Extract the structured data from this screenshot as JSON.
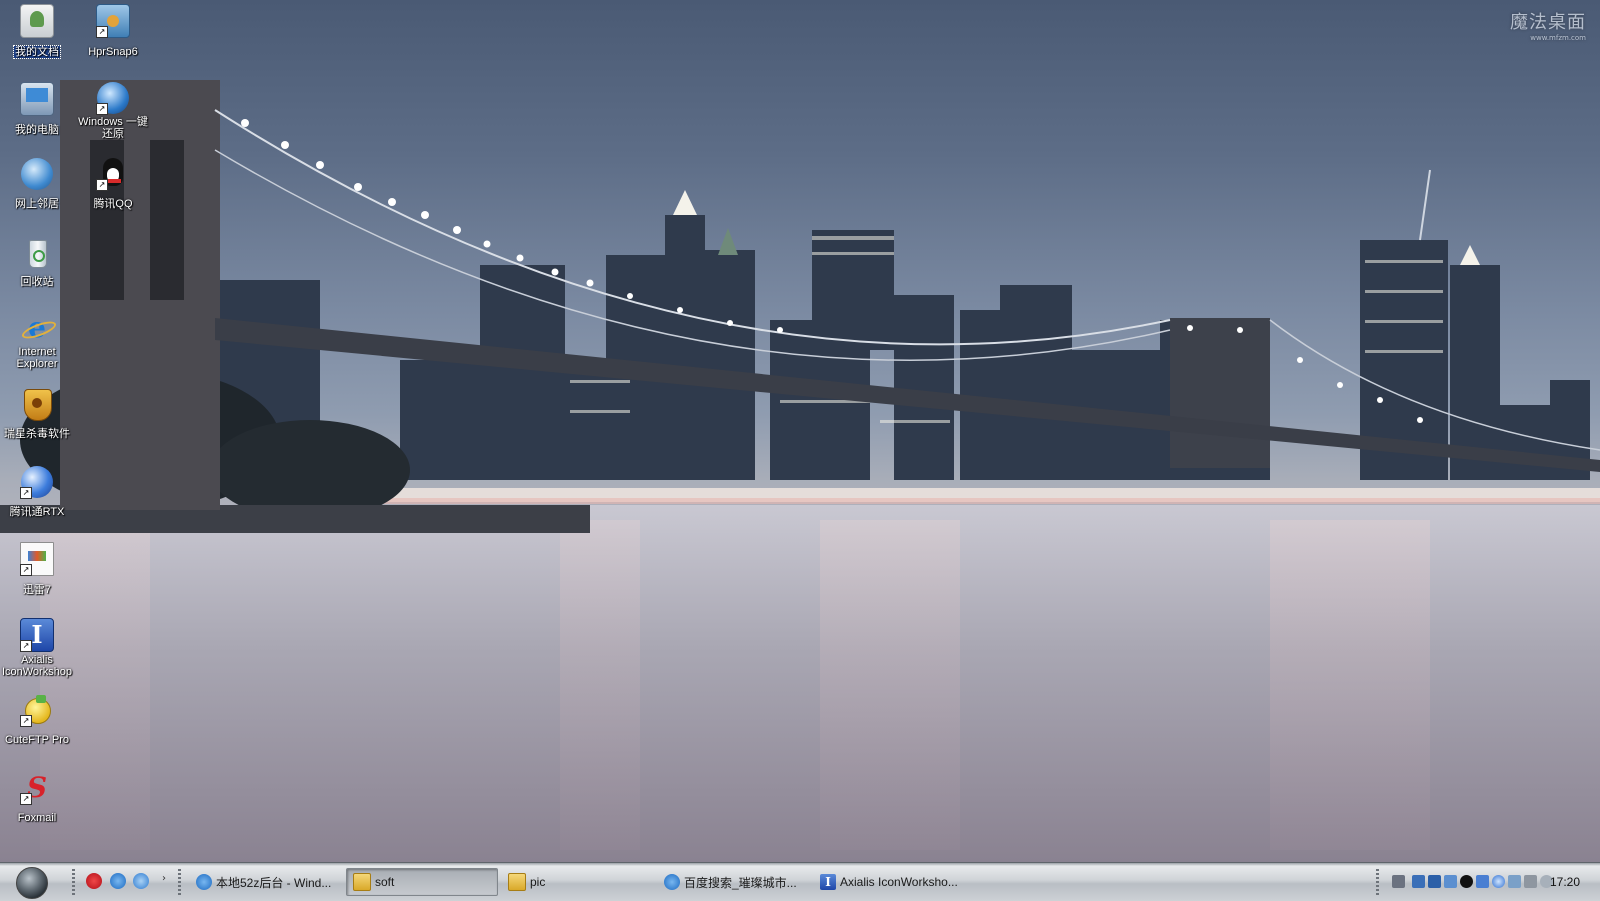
{
  "watermark": {
    "brand": "魔法桌面",
    "url": "www.mfzm.com"
  },
  "desktop_icons": [
    {
      "id": "my-documents",
      "label": "我的文档",
      "icon": "folder-documents-icon",
      "shortcut": false,
      "selected": true
    },
    {
      "id": "hprsnap",
      "label": "HprSnap6",
      "icon": "camera-icon",
      "shortcut": true
    },
    {
      "id": "my-computer",
      "label": "我的电脑",
      "icon": "computer-icon",
      "shortcut": false
    },
    {
      "id": "windows-restore",
      "label": "Windows 一键还原",
      "icon": "restore-globe-icon",
      "shortcut": true
    },
    {
      "id": "network",
      "label": "网上邻居",
      "icon": "network-globe-icon",
      "shortcut": false
    },
    {
      "id": "tencent-qq",
      "label": "腾讯QQ",
      "icon": "penguin-icon",
      "shortcut": true
    },
    {
      "id": "recycle-bin",
      "label": "回收站",
      "icon": "recycle-bin-icon",
      "shortcut": false
    },
    {
      "id": "internet-explorer",
      "label": "Internet Explorer",
      "icon": "ie-icon",
      "shortcut": false
    },
    {
      "id": "rising-antivirus",
      "label": "瑞星杀毒软件",
      "icon": "lion-shield-icon",
      "shortcut": false
    },
    {
      "id": "tencent-rtx",
      "label": "腾讯通RTX",
      "icon": "rtx-icon",
      "shortcut": true
    },
    {
      "id": "thunder",
      "label": "迅雷7",
      "icon": "thunder-icon",
      "shortcut": true
    },
    {
      "id": "axialis",
      "label": "Axialis IconWorkshop",
      "icon": "axialis-icon",
      "shortcut": true
    },
    {
      "id": "cuteftp",
      "label": "CuteFTP Pro",
      "icon": "ftp-icon",
      "shortcut": true
    },
    {
      "id": "foxmail",
      "label": "Foxmail",
      "icon": "foxmail-icon",
      "shortcut": true
    }
  ],
  "taskbar": {
    "quicklaunch": [
      "foxmail-icon",
      "ie-icon",
      "ie-blue-icon"
    ],
    "chevron": "›",
    "buttons": [
      {
        "label": "本地52z后台 - Wind...",
        "icon": "ie-icon",
        "active": false
      },
      {
        "label": "soft",
        "icon": "folder-icon",
        "active": true
      },
      {
        "label": "pic",
        "icon": "folder-icon",
        "active": false
      },
      {
        "label": "百度搜索_璀璨城市...",
        "icon": "ie-icon",
        "active": false
      },
      {
        "label": "Axialis IconWorksho...",
        "icon": "axialis-icon",
        "active": false
      }
    ],
    "tray_icons": [
      "keyboard-icon",
      "network-icon",
      "shield-icon",
      "monitor-icon",
      "qq-icon",
      "display-icon",
      "rtx-icon",
      "speaker-icon",
      "sound-icon",
      "clock-icon"
    ],
    "clock": "17:20"
  },
  "colors": {
    "sky": "#5d6d87",
    "taskbar": "#cfd3d7",
    "accent_select": "#1a3f8a",
    "ie": "#1b79d4",
    "foxmail": "#d8222a",
    "qq": "#111111",
    "folder": "#e8c456"
  }
}
